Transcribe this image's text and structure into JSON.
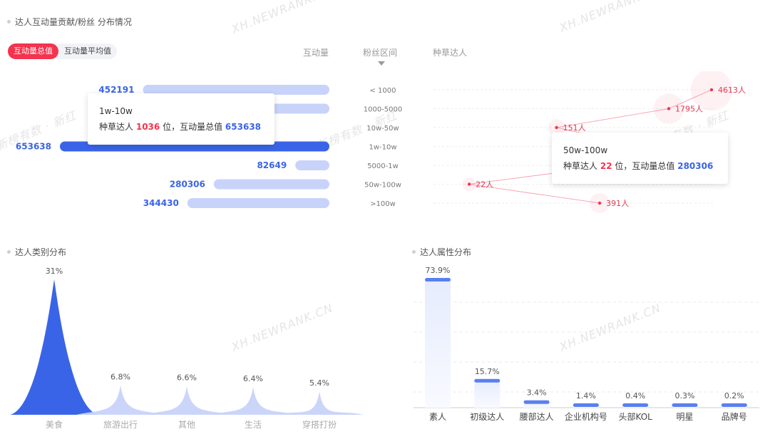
{
  "top": {
    "title": "达人互动量贡献/粉丝 分布情况",
    "tabs": [
      "互动量总值",
      "互动量平均值"
    ],
    "col_interaction": "互动量",
    "col_fans": "粉丝区间",
    "col_seed": "种草达人",
    "tooltip_left": {
      "range": "1w-10w",
      "prefix": "种草达人",
      "count": "1036",
      "mid": "位，互动量总值",
      "value": "653638"
    },
    "tooltip_right": {
      "range": "50w-100w",
      "prefix": "种草达人",
      "count": "22",
      "mid": "位，互动量总值",
      "value": "280306"
    }
  },
  "watermarks": {
    "en": "XH.NEWRANK.CN",
    "cn": "新榜有数 · 新红"
  },
  "colors": {
    "red": "#f4334e",
    "blue": "#3a64e8",
    "light_blue": "#c8d3fa"
  },
  "chart_data": [
    {
      "type": "bar",
      "name": "interaction",
      "categories": [
        "< 1000",
        "1000-5000",
        "10w-50w",
        "1w-10w",
        "5000-1w",
        "50w-100w",
        ">100w"
      ],
      "values": [
        452191,
        277641,
        null,
        653638,
        82649,
        280306,
        344430
      ],
      "value_labels": [
        "452191",
        "277641",
        "",
        "653638",
        "82649",
        "280306",
        "344430"
      ],
      "highlight": "1w-10w"
    },
    {
      "type": "scatter",
      "name": "seed_kols",
      "categories": [
        "< 1000",
        "1000-5000",
        "10w-50w",
        "1w-10w",
        "5000-1w",
        "50w-100w",
        ">100w"
      ],
      "values": [
        4613,
        1795,
        151,
        1036,
        536,
        22,
        391
      ],
      "labels": [
        "4613人",
        "1795人",
        "151人",
        "1036人",
        "536人",
        "22人",
        "391人"
      ]
    },
    {
      "type": "area",
      "title": "达人类别分布",
      "categories": [
        "美食",
        "旅游出行",
        "其他",
        "生活",
        "穿搭打扮"
      ],
      "values": [
        31,
        6.8,
        6.6,
        6.4,
        5.4
      ],
      "labels": [
        "31%",
        "6.8%",
        "6.6%",
        "6.4%",
        "5.4%"
      ]
    },
    {
      "type": "bar",
      "title": "达人属性分布",
      "categories": [
        "素人",
        "初级达人",
        "腰部达人",
        "企业机构号",
        "头部KOL",
        "明星",
        "品牌号"
      ],
      "values": [
        73.9,
        15.7,
        3.4,
        1.4,
        0.4,
        0.3,
        0.2
      ],
      "labels": [
        "73.9%",
        "15.7%",
        "3.4%",
        "1.4%",
        "0.4%",
        "0.3%",
        "0.2%"
      ]
    }
  ]
}
